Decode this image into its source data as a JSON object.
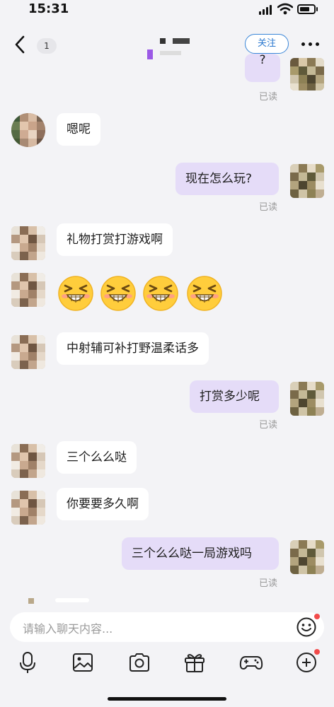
{
  "status_bar": {
    "time": "15:31"
  },
  "header": {
    "back_badge": "1",
    "follow_label": "关注"
  },
  "messages": [
    {
      "side": "out",
      "text": "?",
      "read": "已读"
    },
    {
      "side": "in",
      "text": "嗯呢"
    },
    {
      "side": "out",
      "text": "现在怎么玩?",
      "read": "已读"
    },
    {
      "side": "in",
      "text": "礼物打赏打游戏啊"
    },
    {
      "side": "in",
      "type": "emoji",
      "emoji": "grinning-squinting-face",
      "count": 4
    },
    {
      "side": "in",
      "text": "中射辅可补打野温柔话多"
    },
    {
      "side": "out",
      "text": "打赏多少呢",
      "read": "已读"
    },
    {
      "side": "in",
      "text": "三个么么哒"
    },
    {
      "side": "in",
      "text": "你要要多久啊"
    },
    {
      "side": "out",
      "text": "三个么么哒一局游戏吗",
      "read": "已读"
    }
  ],
  "input": {
    "placeholder": "请输入聊天内容..."
  },
  "toolbar": {
    "items": [
      "microphone-icon",
      "image-icon",
      "camera-icon",
      "gift-icon",
      "gamepad-icon",
      "plus-circle-icon"
    ]
  },
  "colors": {
    "outgoing_bubble": "#e5dcf8",
    "incoming_bubble": "#ffffff",
    "follow_accent": "#3a86d8",
    "badge_red": "#f24b4b"
  }
}
